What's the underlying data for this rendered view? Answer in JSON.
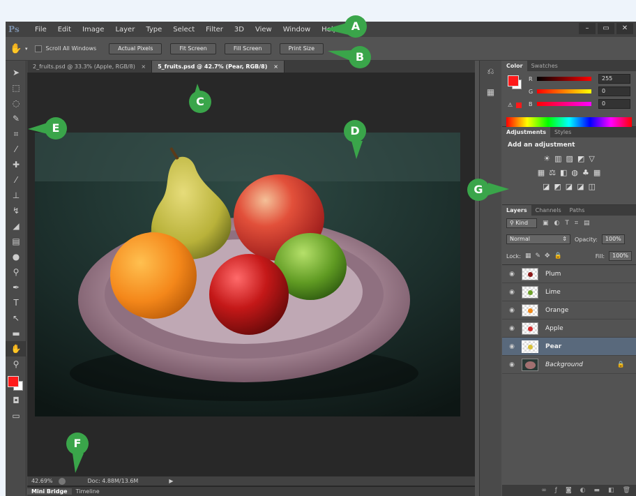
{
  "app": {
    "logo": "Ps"
  },
  "menu": {
    "items": [
      "File",
      "Edit",
      "Image",
      "Layer",
      "Type",
      "Select",
      "Filter",
      "3D",
      "View",
      "Window",
      "Help"
    ]
  },
  "window_buttons": [
    "–",
    "▭",
    "✕"
  ],
  "options": {
    "scroll_all": "Scroll All Windows",
    "buttons": [
      "Actual Pixels",
      "Fit Screen",
      "Fill Screen",
      "Print Size"
    ]
  },
  "doc_tabs": [
    {
      "label": "2_fruits.psd @ 33.3% (Apple, RGB/8)",
      "close": "×"
    },
    {
      "label": "5_fruits.psd @ 42.7% (Pear, RGB/8)",
      "close": "×"
    }
  ],
  "status": {
    "zoom": "42.69%",
    "doc": "Doc: 4.88M/13.6M"
  },
  "bottom_tabs": [
    "Mini Bridge",
    "Timeline"
  ],
  "color_panel": {
    "tabs": [
      "Color",
      "Swatches"
    ],
    "r_label": "R",
    "g_label": "G",
    "b_label": "B",
    "r": "255",
    "g": "0",
    "b": "0",
    "fg_color": "#ff1a1a"
  },
  "adjustments": {
    "tabs": [
      "Adjustments",
      "Styles"
    ],
    "title": "Add an adjustment",
    "row1": [
      "☀",
      "▥",
      "▨",
      "◩",
      "▽"
    ],
    "row2": [
      "▦",
      "⚖",
      "◧",
      "◍",
      "♣",
      "▦"
    ],
    "row3": [
      "◪",
      "◩",
      "◪",
      "◪",
      "◫"
    ]
  },
  "layers": {
    "tabs": [
      "Layers",
      "Channels",
      "Paths"
    ],
    "kind": "Kind",
    "blend": "Normal",
    "opacity_label": "Opacity:",
    "opacity": "100%",
    "lock_label": "Lock:",
    "fill_label": "Fill:",
    "fill": "100%",
    "items": [
      {
        "name": "Plum",
        "color": "#8b1a1a"
      },
      {
        "name": "Lime",
        "color": "#6fa22a"
      },
      {
        "name": "Orange",
        "color": "#f08a1a"
      },
      {
        "name": "Apple",
        "color": "#d42e2e"
      },
      {
        "name": "Pear",
        "color": "#d9c23a"
      },
      {
        "name": "Background",
        "color": "#a07070"
      }
    ]
  },
  "callouts": [
    "A",
    "B",
    "C",
    "D",
    "E",
    "F",
    "G"
  ]
}
